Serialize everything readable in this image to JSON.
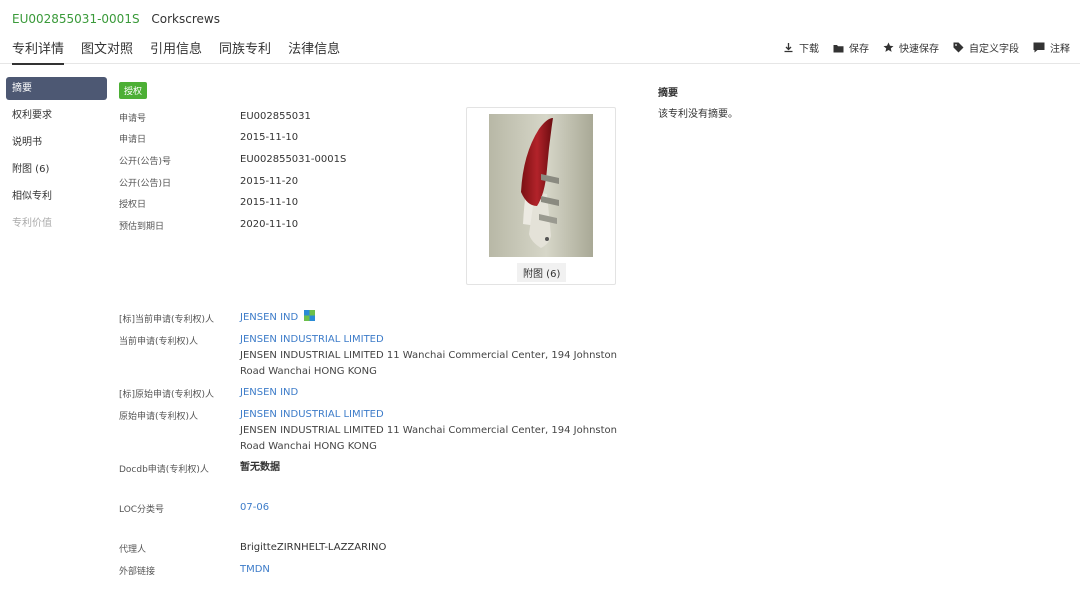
{
  "header": {
    "pub_no": "EU002855031-0001S",
    "title": "Corkscrews",
    "tabs": [
      "专利详情",
      "图文对照",
      "引用信息",
      "同族专利",
      "法律信息"
    ]
  },
  "toolbar": {
    "download": "下载",
    "save": "保存",
    "quick_save": "快速保存",
    "custom_field": "自定义字段",
    "comment": "注释"
  },
  "sidebar": {
    "items": [
      "摘要",
      "权利要求",
      "说明书",
      "附图 (6)",
      "相似专利",
      "专利价值"
    ]
  },
  "status_badge": "授权",
  "basic_info": {
    "app_no_label": "申请号",
    "app_no": "EU002855031",
    "app_date_label": "申请日",
    "app_date": "2015-11-10",
    "pub_no_label": "公开(公告)号",
    "pub_no": "EU002855031-0001S",
    "pub_date_label": "公开(公告)日",
    "pub_date": "2015-11-20",
    "grant_date_label": "授权日",
    "grant_date": "2015-11-10",
    "expiry_label": "预估到期日",
    "expiry": "2020-11-10"
  },
  "figure": {
    "caption": "附图 (6)"
  },
  "parties": {
    "std_current_label": "[标]当前申请(专利权)人",
    "std_current": "JENSEN IND",
    "current_label": "当前申请(专利权)人",
    "current_name": "JENSEN INDUSTRIAL LIMITED",
    "current_addr1": "JENSEN INDUSTRIAL LIMITED 11 Wanchai Commercial Center, 194 Johnston",
    "current_addr2": "Road Wanchai HONG KONG",
    "std_orig_label": "[标]原始申请(专利权)人",
    "std_orig": "JENSEN IND",
    "orig_label": "原始申请(专利权)人",
    "orig_name": "JENSEN INDUSTRIAL LIMITED",
    "orig_addr1": "JENSEN INDUSTRIAL LIMITED 11 Wanchai Commercial Center, 194 Johnston",
    "orig_addr2": "Road Wanchai HONG KONG",
    "docdb_label": "Docdb申请(专利权)人",
    "docdb": "暂无数据"
  },
  "classification": {
    "loc_label": "LOC分类号",
    "loc": "07-06"
  },
  "other": {
    "agent_label": "代理人",
    "agent": "BrigitteZIRNHELT-LAZZARINO",
    "ext_link_label": "外部链接",
    "ext_link": "TMDN"
  },
  "abstract": {
    "title": "摘要",
    "text": "该专利没有摘要。"
  },
  "colors": {
    "pub_no_green": "#3a9a3a",
    "link_blue": "#3d7cc9",
    "badge_green": "#4caf35",
    "sidebar_active": "#4d5873"
  }
}
